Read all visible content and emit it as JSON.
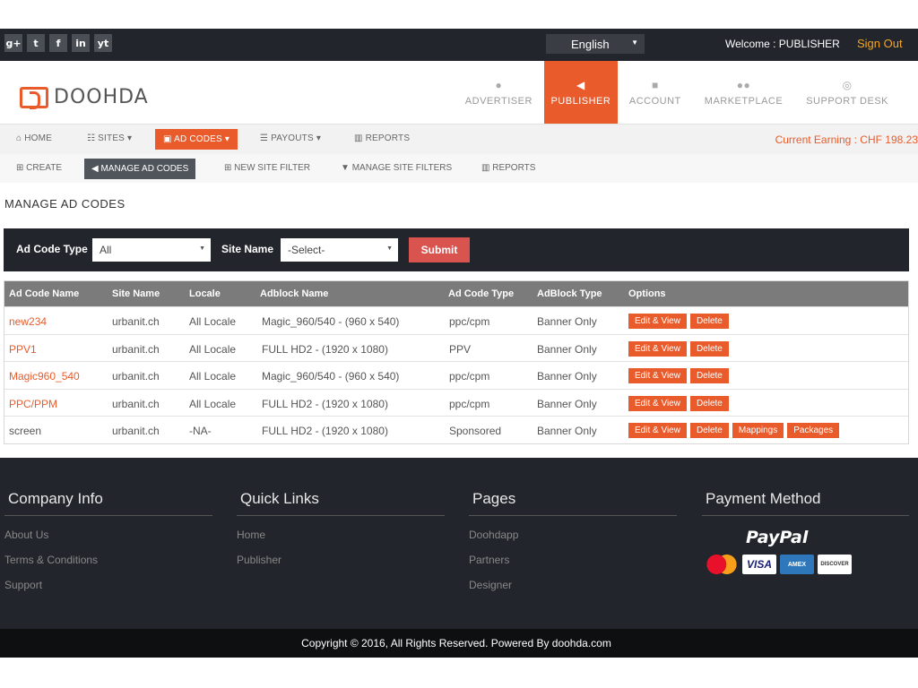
{
  "topbar": {
    "social": [
      "g+",
      "t",
      "f",
      "in",
      "yt"
    ],
    "language": "English",
    "welcome": "Welcome : PUBLISHER",
    "sign_out": "Sign Out"
  },
  "header": {
    "logo_text": "DOOHDA",
    "nav": [
      {
        "label": "ADVERTISER",
        "icon": "user-icon"
      },
      {
        "label": "PUBLISHER",
        "icon": "megaphone-icon"
      },
      {
        "label": "ACCOUNT",
        "icon": "briefcase-icon"
      },
      {
        "label": "MARKETPLACE",
        "icon": "users-icon"
      },
      {
        "label": "SUPPORT DESK",
        "icon": "lifebuoy-icon"
      }
    ]
  },
  "subnav1": {
    "items": [
      "HOME",
      "SITES",
      "AD CODES",
      "PAYOUTS",
      "REPORTS"
    ],
    "earning": "Current Earning : CHF 198.23"
  },
  "subnav2": {
    "items": [
      "CREATE",
      "MANAGE AD CODES",
      "NEW SITE FILTER",
      "MANAGE SITE FILTERS",
      "REPORTS"
    ]
  },
  "page_title": "MANAGE AD CODES",
  "filter": {
    "ad_code_type_label": "Ad Code Type",
    "ad_code_type_value": "All",
    "site_name_label": "Site Name",
    "site_name_value": "-Select-",
    "submit": "Submit"
  },
  "table": {
    "headers": [
      "Ad Code Name",
      "Site Name",
      "Locale",
      "Adblock Name",
      "Ad Code Type",
      "AdBlock Type",
      "Options"
    ],
    "rows": [
      {
        "name": "new234",
        "site": "urbanit.ch",
        "locale": "All Locale",
        "adblock": "Magic_960/540 - (960 x 540)",
        "type": "ppc/cpm",
        "block_type": "Banner Only"
      },
      {
        "name": "PPV1",
        "site": "urbanit.ch",
        "locale": "All Locale",
        "adblock": "FULL HD2 - (1920 x 1080)",
        "type": "PPV",
        "block_type": "Banner Only"
      },
      {
        "name": "Magic960_540",
        "site": "urbanit.ch",
        "locale": "All Locale",
        "adblock": "Magic_960/540 - (960 x 540)",
        "type": "ppc/cpm",
        "block_type": "Banner Only"
      },
      {
        "name": "PPC/PPM",
        "site": "urbanit.ch",
        "locale": "All Locale",
        "adblock": "FULL HD2 - (1920 x 1080)",
        "type": "ppc/cpm",
        "block_type": "Banner Only"
      },
      {
        "name": "screen",
        "site": "urbanit.ch",
        "locale": "-NA-",
        "adblock": "FULL HD2 - (1920 x 1080)",
        "type": "Sponsored",
        "block_type": "Banner Only"
      }
    ],
    "options": {
      "edit": "Edit & View",
      "delete": "Delete",
      "mappings": "Mappings",
      "packages": "Packages"
    }
  },
  "footer": {
    "company_info": {
      "title": "Company Info",
      "links": [
        "About Us",
        "Terms & Conditions",
        "Support"
      ]
    },
    "quick_links": {
      "title": "Quick Links",
      "links": [
        "Home",
        "Publisher"
      ]
    },
    "pages": {
      "title": "Pages",
      "links": [
        "Doohdapp",
        "Partners",
        "Designer"
      ]
    },
    "payment": {
      "title": "Payment Method",
      "paypal": "PayPal",
      "cards": [
        "MasterCard",
        "VISA",
        "AMEX",
        "DISCOVER"
      ]
    },
    "copyright": "Copyright © 2016, All Rights Reserved. Powered By doohda.com"
  },
  "colors": {
    "accent": "#e95b2b",
    "dark": "#22252b",
    "submit": "#d9534f"
  }
}
